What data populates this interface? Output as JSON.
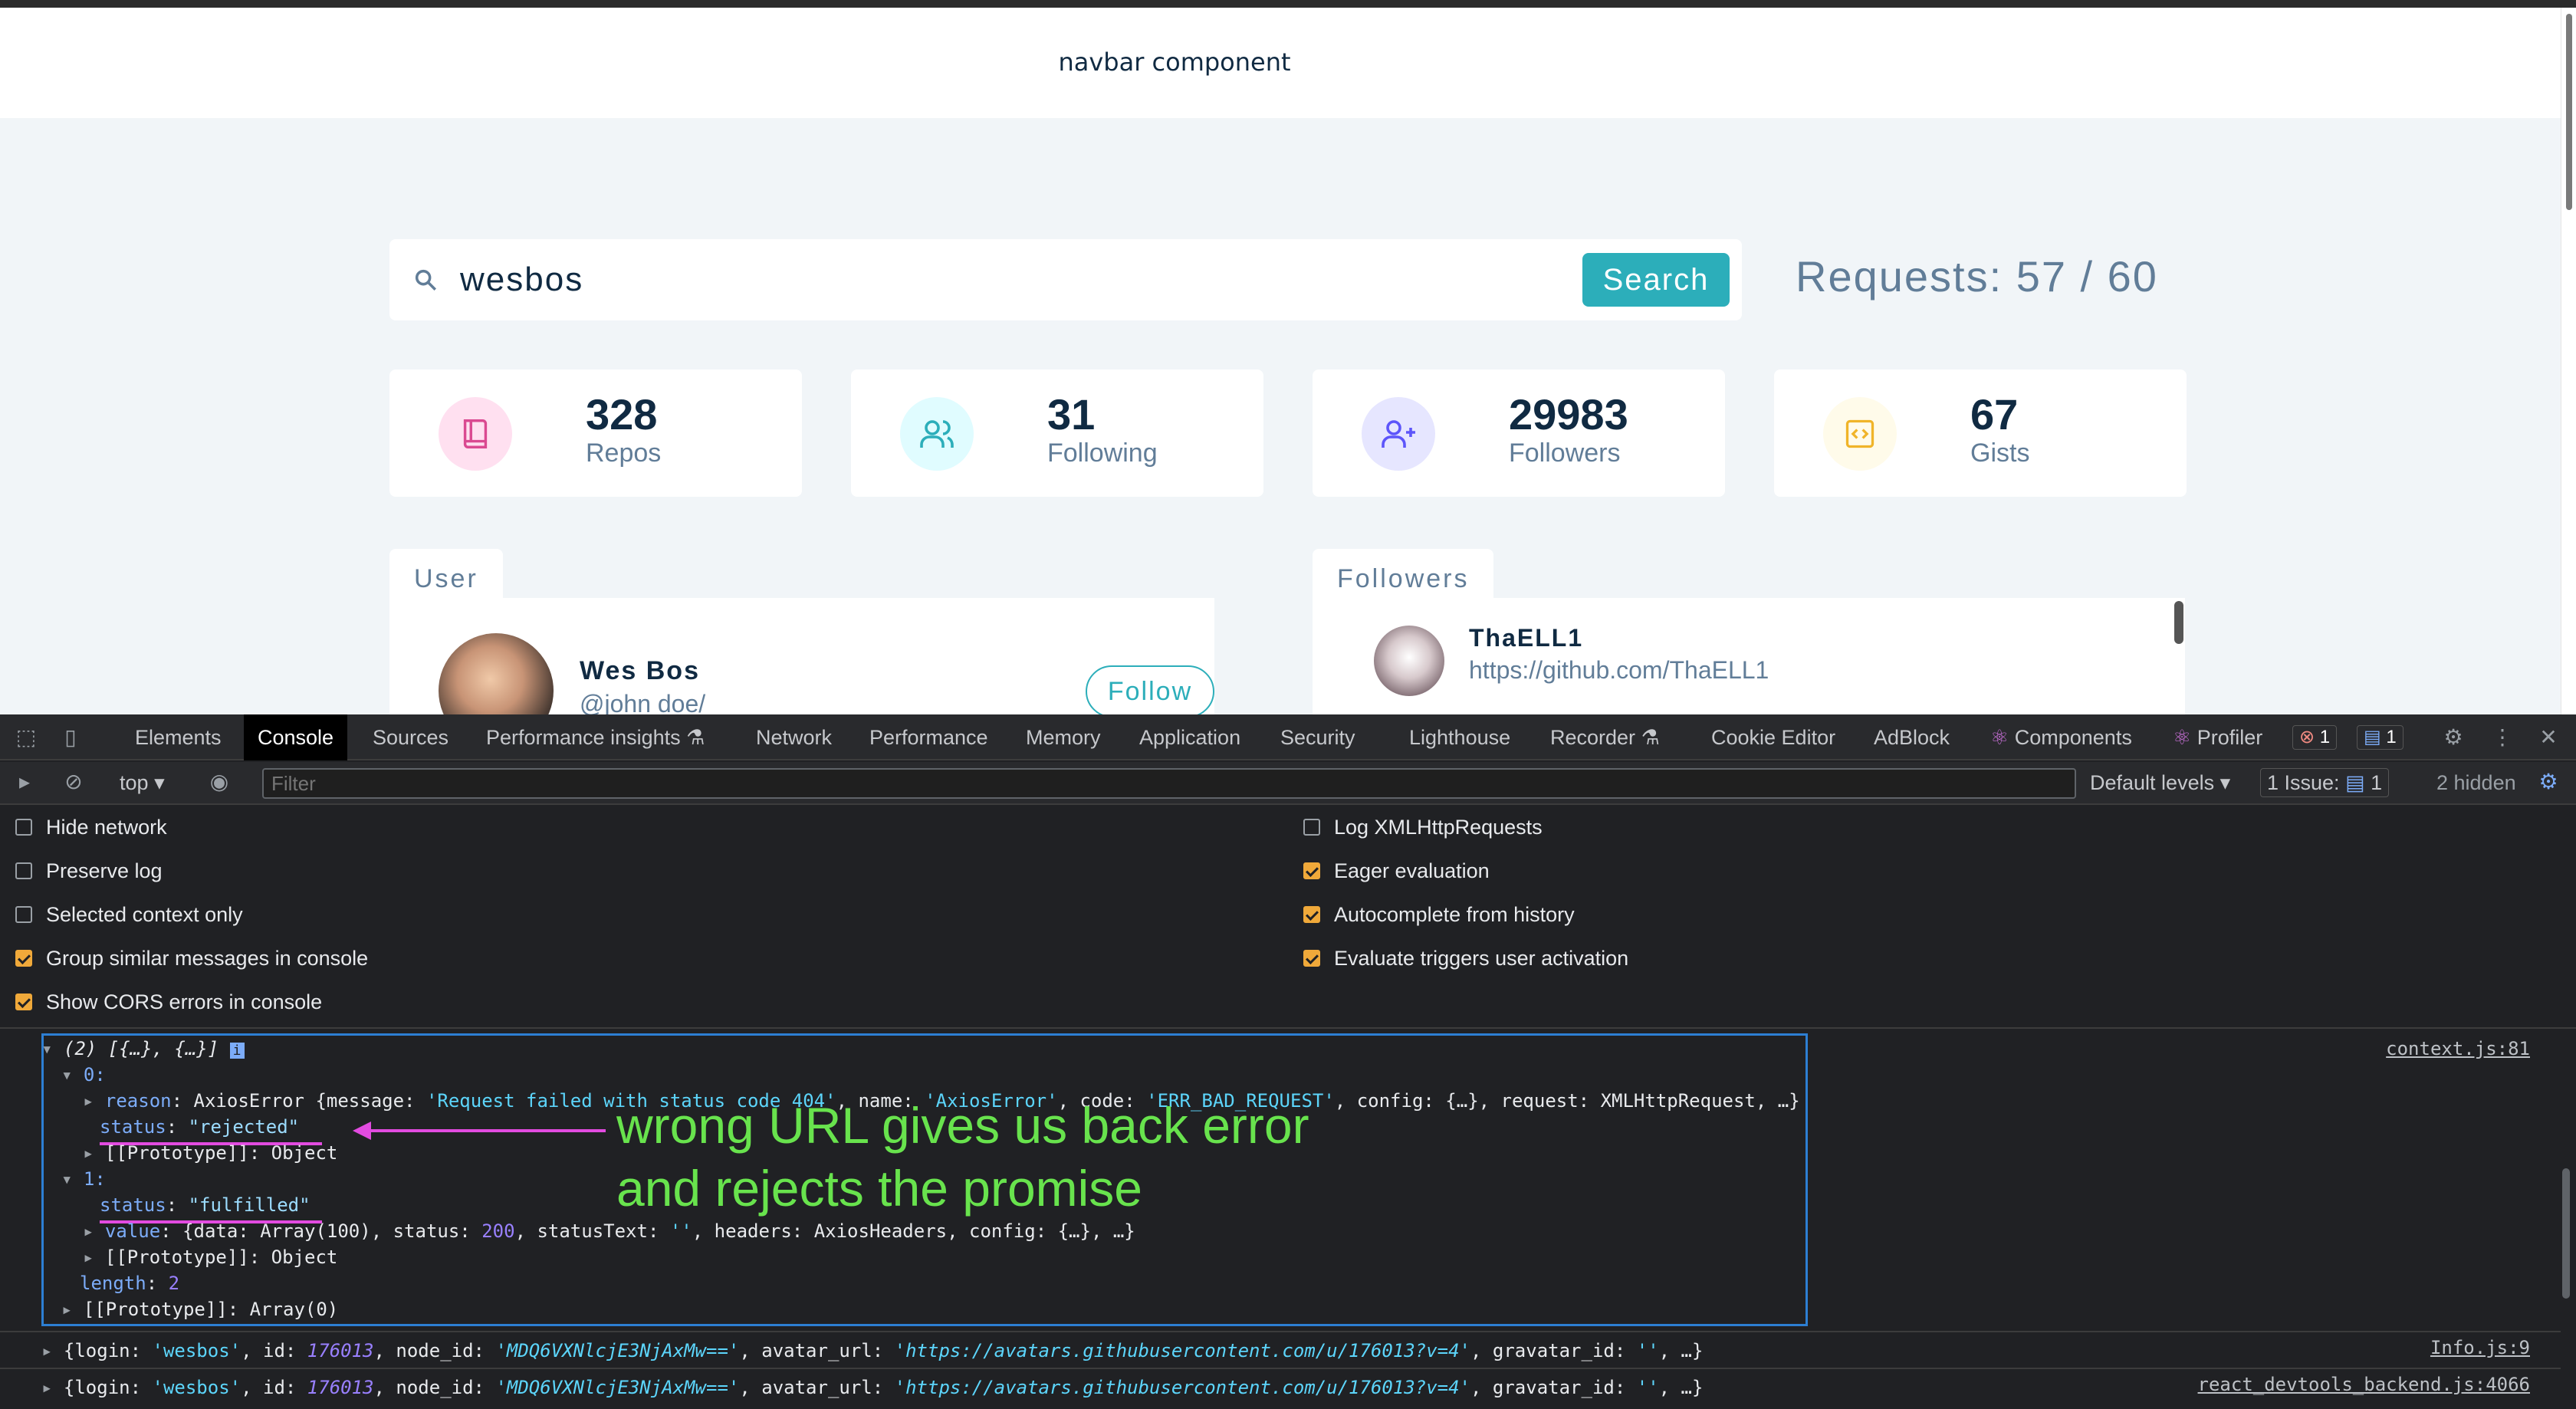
{
  "navbar": {
    "title": "navbar component"
  },
  "search": {
    "value": "wesbos",
    "button": "Search"
  },
  "requests": "Requests: 57 / 60",
  "stats": [
    {
      "count": "328",
      "label": "Repos",
      "icon": "book-icon",
      "color": "#da4a91",
      "bg": "#ffe0f0"
    },
    {
      "count": "31",
      "label": "Following",
      "icon": "users-icon",
      "color": "#2caeba",
      "bg": "#e0fcff"
    },
    {
      "count": "29983",
      "label": "Followers",
      "icon": "user-plus-icon",
      "color": "#5d55fa",
      "bg": "#e6e6ff"
    },
    {
      "count": "67",
      "label": "Gists",
      "icon": "code-icon",
      "color": "#f0b429",
      "bg": "#fffbea"
    }
  ],
  "user_card": {
    "tab": "User",
    "name": "Wes Bos",
    "handle": "@john doe/",
    "follow": "Follow"
  },
  "followers_card": {
    "tab": "Followers",
    "name": "ThaELL1",
    "url": "https://github.com/ThaELL1"
  },
  "devtools": {
    "tabs": [
      "Elements",
      "Console",
      "Sources",
      "Performance insights",
      "Network",
      "Performance",
      "Memory",
      "Application",
      "Security",
      "Lighthouse",
      "Recorder",
      "Cookie Editor",
      "AdBlock",
      "Components",
      "Profiler"
    ],
    "errors_badge": "1",
    "messages_badge": "1",
    "context": "top",
    "filter_placeholder": "Filter",
    "levels": "Default levels",
    "issues": "1 Issue:",
    "issues_count": "1",
    "hidden": "2 hidden",
    "settings_left": [
      {
        "label": "Hide network",
        "checked": false
      },
      {
        "label": "Preserve log",
        "checked": false
      },
      {
        "label": "Selected context only",
        "checked": false
      },
      {
        "label": "Group similar messages in console",
        "checked": true
      },
      {
        "label": "Show CORS errors in console",
        "checked": true
      }
    ],
    "settings_right": [
      {
        "label": "Log XMLHttpRequests",
        "checked": false
      },
      {
        "label": "Eager evaluation",
        "checked": true
      },
      {
        "label": "Autocomplete from history",
        "checked": true
      },
      {
        "label": "Evaluate triggers user activation",
        "checked": true
      }
    ]
  },
  "console": {
    "src1": "context.js:81",
    "line_array": "(2) [{…}, {…}]",
    "idx0": "0:",
    "reason_key": "reason",
    "reason_val_a": "AxiosError {message: ",
    "reason_msg": "'Request failed with status code 404'",
    "reason_val_b": ", name: ",
    "reason_name": "'AxiosError'",
    "reason_val_c": ", code: ",
    "reason_code": "'ERR_BAD_REQUEST'",
    "reason_val_d": ", config: {…}, request: XMLHttpRequest, …}",
    "status_key": "status",
    "status_rejected": "\"rejected\"",
    "proto_obj": "[[Prototype]]: Object",
    "idx1": "1:",
    "status_fulfilled": "\"fulfilled\"",
    "value_key": "value",
    "value_a": "{data: Array(100), status: ",
    "value_num": "200",
    "value_b": ", statusText: ",
    "value_str": "''",
    "value_c": ", headers: AxiosHeaders, config: {…}, …}",
    "length_key": "length",
    "length_val": "2",
    "proto_arr": "[[Prototype]]: Array(0)",
    "log_a": "{login: ",
    "log_login": "'wesbos'",
    "log_b": ", id: ",
    "log_id": "176013",
    "log_c": ", node_id: ",
    "log_node": "'MDQ6VXNlcjE3NjAxMw=='",
    "log_d": ", avatar_url: ",
    "log_url": "'https://avatars.githubusercontent.com/u/176013?v=4'",
    "log_e": ", gravatar_id: ",
    "log_grav": "''",
    "log_f": ", …}",
    "src2": "Info.js:9",
    "src3": "react_devtools_backend.js:4066"
  },
  "annotation": {
    "line1": "wrong URL gives us back error",
    "line2": "and rejects the promise"
  }
}
